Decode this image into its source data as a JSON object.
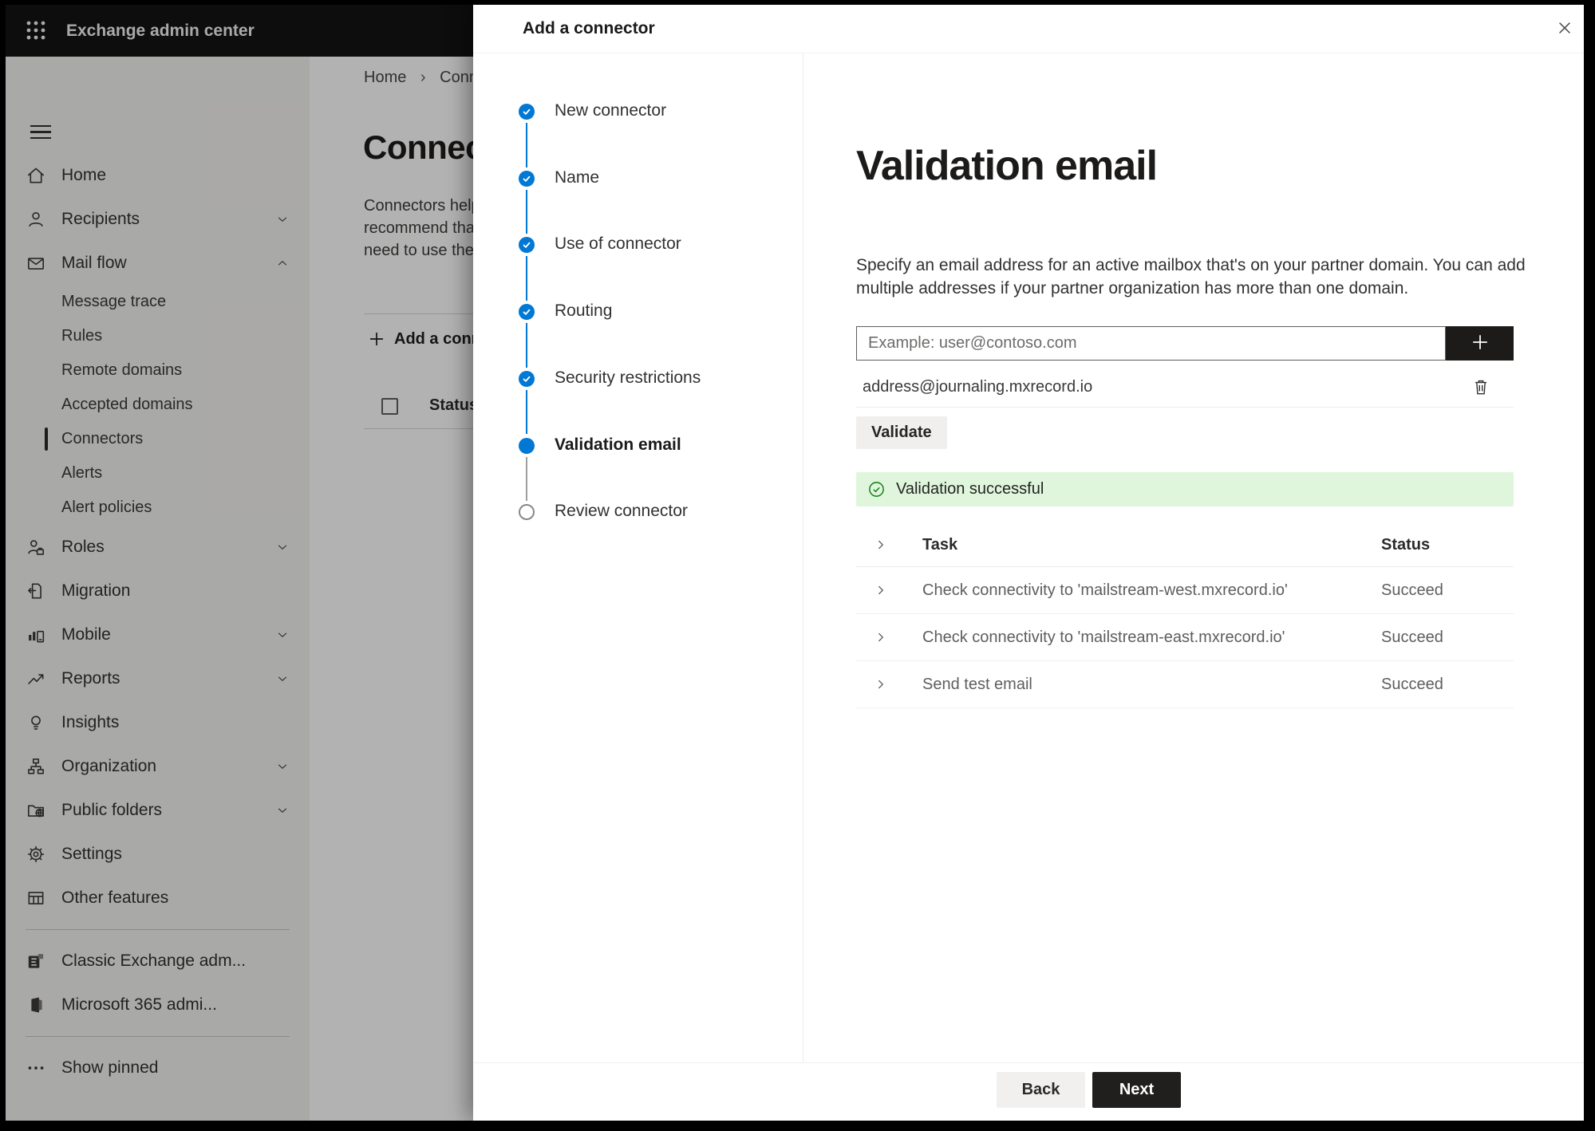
{
  "topbar": {
    "title": "Exchange admin center"
  },
  "sidebar": {
    "items": [
      {
        "label": "Home",
        "icon": "home-icon"
      },
      {
        "label": "Recipients",
        "icon": "person-icon",
        "chevron": "down"
      },
      {
        "label": "Mail flow",
        "icon": "mail-icon",
        "chevron": "up"
      },
      {
        "label": "Message trace",
        "sub": true
      },
      {
        "label": "Rules",
        "sub": true
      },
      {
        "label": "Remote domains",
        "sub": true
      },
      {
        "label": "Accepted domains",
        "sub": true
      },
      {
        "label": "Connectors",
        "sub": true,
        "selected": true
      },
      {
        "label": "Alerts",
        "sub": true
      },
      {
        "label": "Alert policies",
        "sub": true
      },
      {
        "label": "Roles",
        "icon": "roles-icon",
        "chevron": "down"
      },
      {
        "label": "Migration",
        "icon": "migration-icon"
      },
      {
        "label": "Mobile",
        "icon": "mobile-icon",
        "chevron": "down"
      },
      {
        "label": "Reports",
        "icon": "reports-icon",
        "chevron": "down"
      },
      {
        "label": "Insights",
        "icon": "insights-icon"
      },
      {
        "label": "Organization",
        "icon": "organization-icon",
        "chevron": "down"
      },
      {
        "label": "Public folders",
        "icon": "public-folders-icon",
        "chevron": "down"
      },
      {
        "label": "Settings",
        "icon": "settings-icon"
      },
      {
        "label": "Other features",
        "icon": "other-features-icon"
      },
      {
        "divider": true
      },
      {
        "label": "Classic Exchange adm...",
        "icon": "classic-exchange-icon"
      },
      {
        "label": "Microsoft 365 admi...",
        "icon": "microsoft-365-icon"
      },
      {
        "divider": true
      },
      {
        "label": "Show pinned",
        "icon": "ellipsis-icon"
      }
    ]
  },
  "page": {
    "breadcrumb": {
      "items": [
        "Home",
        "Connectors"
      ],
      "separator": "›"
    },
    "title": "Connectors",
    "intro_lines": [
      "Connectors help",
      "recommend that",
      "need to use them"
    ],
    "add_button": "Add a connector",
    "list_header": "Status"
  },
  "dialog": {
    "title": "Add a connector",
    "steps": [
      {
        "label": "New connector",
        "state": "done"
      },
      {
        "label": "Name",
        "state": "done"
      },
      {
        "label": "Use of connector",
        "state": "done"
      },
      {
        "label": "Routing",
        "state": "done"
      },
      {
        "label": "Security restrictions",
        "state": "done"
      },
      {
        "label": "Validation email",
        "state": "current"
      },
      {
        "label": "Review connector",
        "state": "upcoming"
      }
    ],
    "heading": "Validation email",
    "description_lines": [
      "Specify an email address for an active mailbox that's on your partner domain. You can add",
      "multiple addresses if your partner organization has more than one domain."
    ],
    "email_input_placeholder": "Example: user@contoso.com",
    "added_address": "address@journaling.mxrecord.io",
    "validate_button": "Validate",
    "success_message": "Validation successful",
    "results_table": {
      "columns": [
        "Task",
        "Status"
      ],
      "rows": [
        {
          "task": "Check connectivity to 'mailstream-west.mxrecord.io'",
          "status": "Succeed"
        },
        {
          "task": "Check connectivity to 'mailstream-east.mxrecord.io'",
          "status": "Succeed"
        },
        {
          "task": "Send test email",
          "status": "Succeed"
        }
      ]
    },
    "back_button": "Back",
    "next_button": "Next"
  },
  "colors": {
    "accent": "#0078d4",
    "success_bg": "#dff6dd",
    "success_green": "#107c10",
    "topbar_bg": "#141414"
  }
}
